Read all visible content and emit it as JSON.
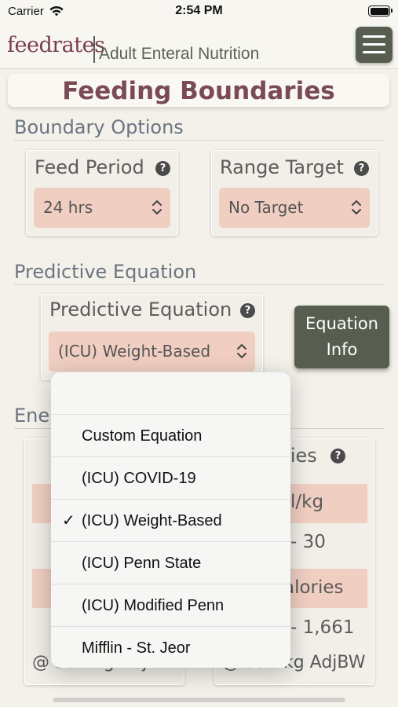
{
  "status_bar": {
    "carrier": "Carrier",
    "time": "2:54 PM"
  },
  "header": {
    "logo": "feedrates",
    "subtitle": "Adult Enteral Nutrition"
  },
  "page_title": "Feeding Boundaries",
  "boundary_options": {
    "heading": "Boundary Options",
    "feed_period": {
      "label": "Feed Period",
      "value": "24 hrs"
    },
    "range_target": {
      "label": "Range Target",
      "value": "No Target"
    }
  },
  "predictive": {
    "heading": "Predictive Equation",
    "label": "Predictive Equation",
    "value": "(ICU) Weight-Based",
    "info_button": "Equation\nInfo"
  },
  "background": {
    "heading_fragment": "Ene",
    "calories_fragment": "ries",
    "per_kg_fragment": "l/kg",
    "range_fragment": "- 30",
    "calories_label_fragment": "alories",
    "calories_range_fragment": "- 1,661",
    "weight_left_fragment": "@ 59.4kg AdjBW",
    "weight_right_fragment": "@ 59.4kg AdjBW"
  },
  "dropdown": {
    "items": [
      {
        "label": "Custom Equation",
        "selected": false
      },
      {
        "label": "(ICU) COVID-19",
        "selected": false
      },
      {
        "label": "(ICU) Weight-Based",
        "selected": true
      },
      {
        "label": "(ICU) Penn State",
        "selected": false
      },
      {
        "label": "(ICU) Modified Penn",
        "selected": false
      },
      {
        "label": "Mifflin - St. Jeor",
        "selected": false
      }
    ],
    "check_glyph": "✓"
  },
  "help_glyph": "?",
  "colors": {
    "brand": "#7a3d4c",
    "accent_dark": "#585e4f",
    "select_bg": "#f0cfc2",
    "background": "#f3f1ea"
  }
}
